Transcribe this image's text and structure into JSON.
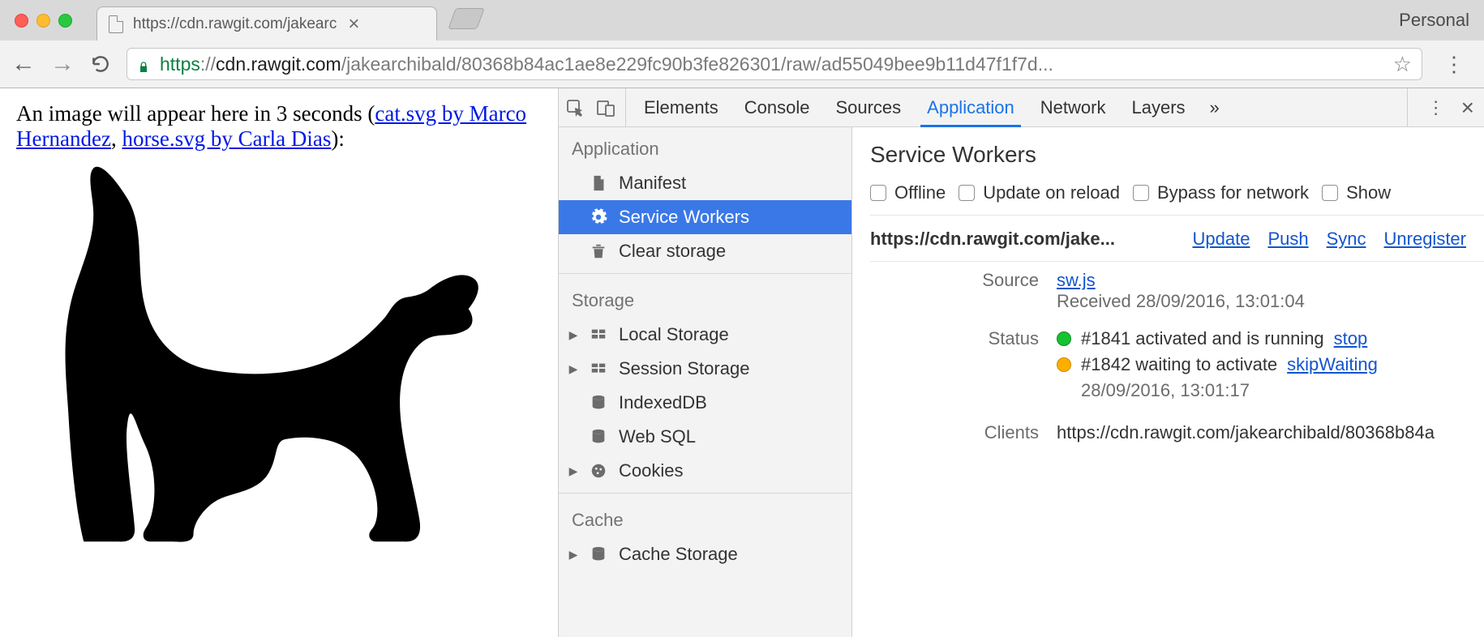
{
  "chrome": {
    "tab_title": "https://cdn.rawgit.com/jakearc",
    "personal_label": "Personal",
    "url": {
      "https": "https",
      "sep": "://",
      "host": "cdn.rawgit.com",
      "path": "/jakearchibald/80368b84ac1ae8e229fc90b3fe826301/raw/ad55049bee9b11d47f1f7d..."
    }
  },
  "page": {
    "text_before": "An image will appear here in 3 seconds (",
    "link1": "cat.svg by Marco Hernandez",
    "sep": ", ",
    "link2": "horse.svg by Carla Dias",
    "text_after": "):"
  },
  "devtools": {
    "tabs": [
      "Elements",
      "Console",
      "Sources",
      "Application",
      "Network",
      "Layers"
    ],
    "active_tab_index": 3,
    "sidebar": {
      "g_app": "Application",
      "app_items": [
        "Manifest",
        "Service Workers",
        "Clear storage"
      ],
      "app_selected_index": 1,
      "g_storage": "Storage",
      "storage_items": [
        "Local Storage",
        "Session Storage",
        "IndexedDB",
        "Web SQL",
        "Cookies"
      ],
      "g_cache": "Cache",
      "cache_items": [
        "Cache Storage"
      ]
    },
    "panel": {
      "title": "Service Workers",
      "checks": [
        "Offline",
        "Update on reload",
        "Bypass for network",
        "Show"
      ],
      "origin": "https://cdn.rawgit.com/jake...",
      "actions": [
        "Update",
        "Push",
        "Sync",
        "Unregister"
      ],
      "source_label": "Source",
      "source_file": "sw.js",
      "source_received": "Received 28/09/2016, 13:01:04",
      "status_label": "Status",
      "status_1_text": "#1841 activated and is running",
      "status_1_link": "stop",
      "status_2_text": "#1842 waiting to activate",
      "status_2_link": "skipWaiting",
      "status_2_time": "28/09/2016, 13:01:17",
      "clients_label": "Clients",
      "clients_value": "https://cdn.rawgit.com/jakearchibald/80368b84a"
    }
  }
}
